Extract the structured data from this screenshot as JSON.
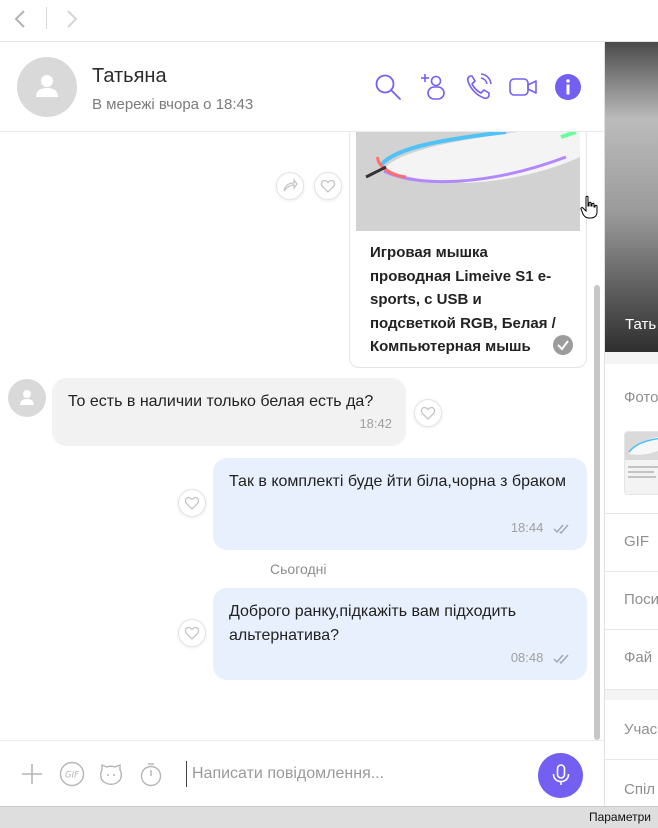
{
  "header": {
    "contact_name": "Татьяна",
    "status": "В мережі вчора о 18:43"
  },
  "card": {
    "title": "Игровая мышка проводная Limeive S1 e-sports, с USB и подсветкой RGB, Белая / Компьютерная мышь"
  },
  "messages": [
    {
      "direction": "in",
      "text": "То есть в наличии только белая есть да?",
      "time": "18:42"
    },
    {
      "direction": "out",
      "text": "Так в комплекті буде йти біла,чорна з браком",
      "time": "18:44"
    },
    {
      "direction": "out",
      "text": "Доброго ранку,підкажіть вам підходить альтернатива?",
      "time": "08:48"
    }
  ],
  "day_divider": "Сьогодні",
  "composer": {
    "placeholder": "Написати повідомлення..."
  },
  "info_panel": {
    "name": "Тать",
    "sections": [
      "Фото",
      "GIF",
      "Поси",
      "Фай",
      "Учас",
      "Спіл"
    ]
  },
  "statusbar": {
    "label": "Параметри"
  },
  "colors": {
    "accent": "#7360f2",
    "outgoing_bubble": "#e8f0fd",
    "incoming_bubble": "#f2f2f2"
  }
}
